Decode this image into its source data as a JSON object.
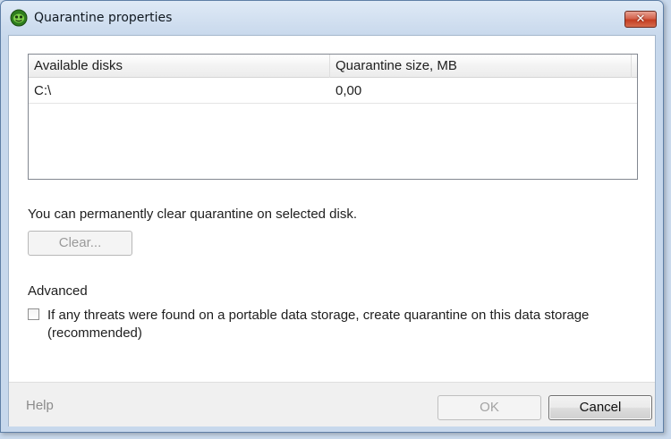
{
  "window": {
    "title": "Quarantine properties",
    "icon": "kaspersky-shield-icon",
    "close_glyph": "✕"
  },
  "disks_table": {
    "columns": [
      "Available disks",
      "Quarantine size, MB"
    ],
    "rows": [
      {
        "disk": "C:\\",
        "size": "0,00"
      }
    ]
  },
  "clear_section": {
    "info_text": "You can permanently clear quarantine on selected disk.",
    "clear_button": "Clear...",
    "clear_enabled": false
  },
  "advanced": {
    "heading": "Advanced",
    "portable_checkbox_label": "If any threats were found on a portable data storage, create quarantine on this data storage (recommended)",
    "portable_checked": false
  },
  "footer": {
    "help_link": "Help",
    "ok_button": "OK",
    "ok_enabled": false,
    "cancel_button": "Cancel"
  },
  "colors": {
    "titlebar": "#cddcee",
    "close_button": "#c43d22",
    "footer_bg": "#f0f0f0",
    "disabled_text": "#9a9a9a"
  }
}
